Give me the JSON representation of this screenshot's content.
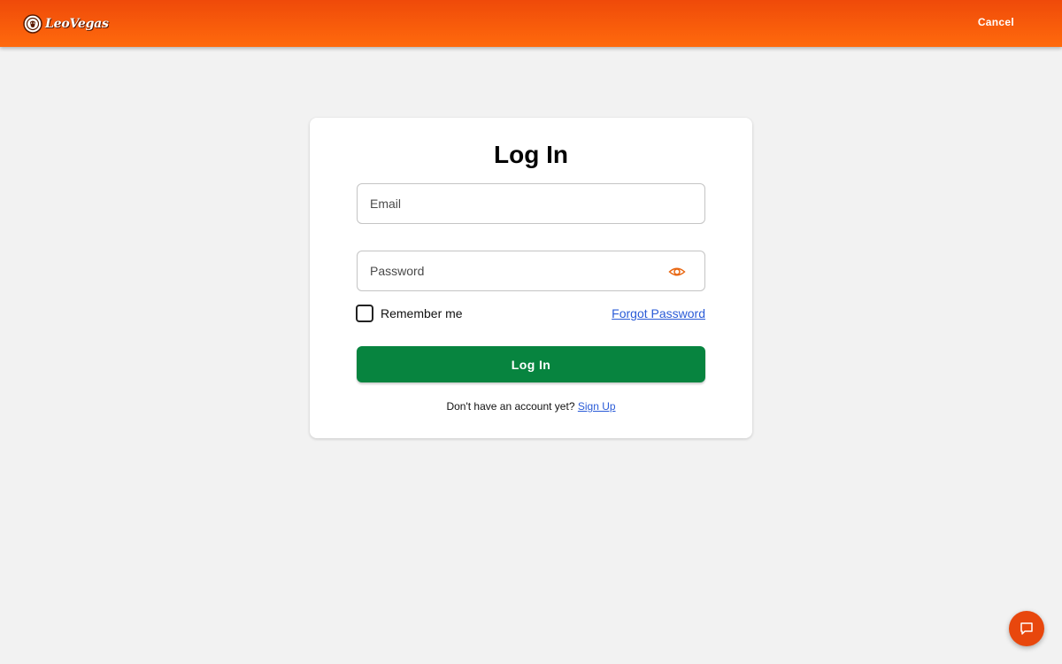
{
  "header": {
    "logo_text": "LeoVegas",
    "cancel_label": "Cancel",
    "brand_color": "#f05a0a"
  },
  "login_form": {
    "title": "Log In",
    "email": {
      "placeholder": "Email",
      "value": ""
    },
    "password": {
      "placeholder": "Password",
      "value": "",
      "toggle_icon": "eye-icon"
    },
    "remember_me": {
      "label": "Remember me",
      "checked": false
    },
    "forgot_password_label": "Forgot Password",
    "submit_label": "Log In",
    "signup_prompt": "Don't have an account yet?",
    "signup_link_label": "Sign Up",
    "submit_color": "#07843f",
    "link_color": "#2a5bd7"
  },
  "chat": {
    "icon": "chat-icon"
  }
}
